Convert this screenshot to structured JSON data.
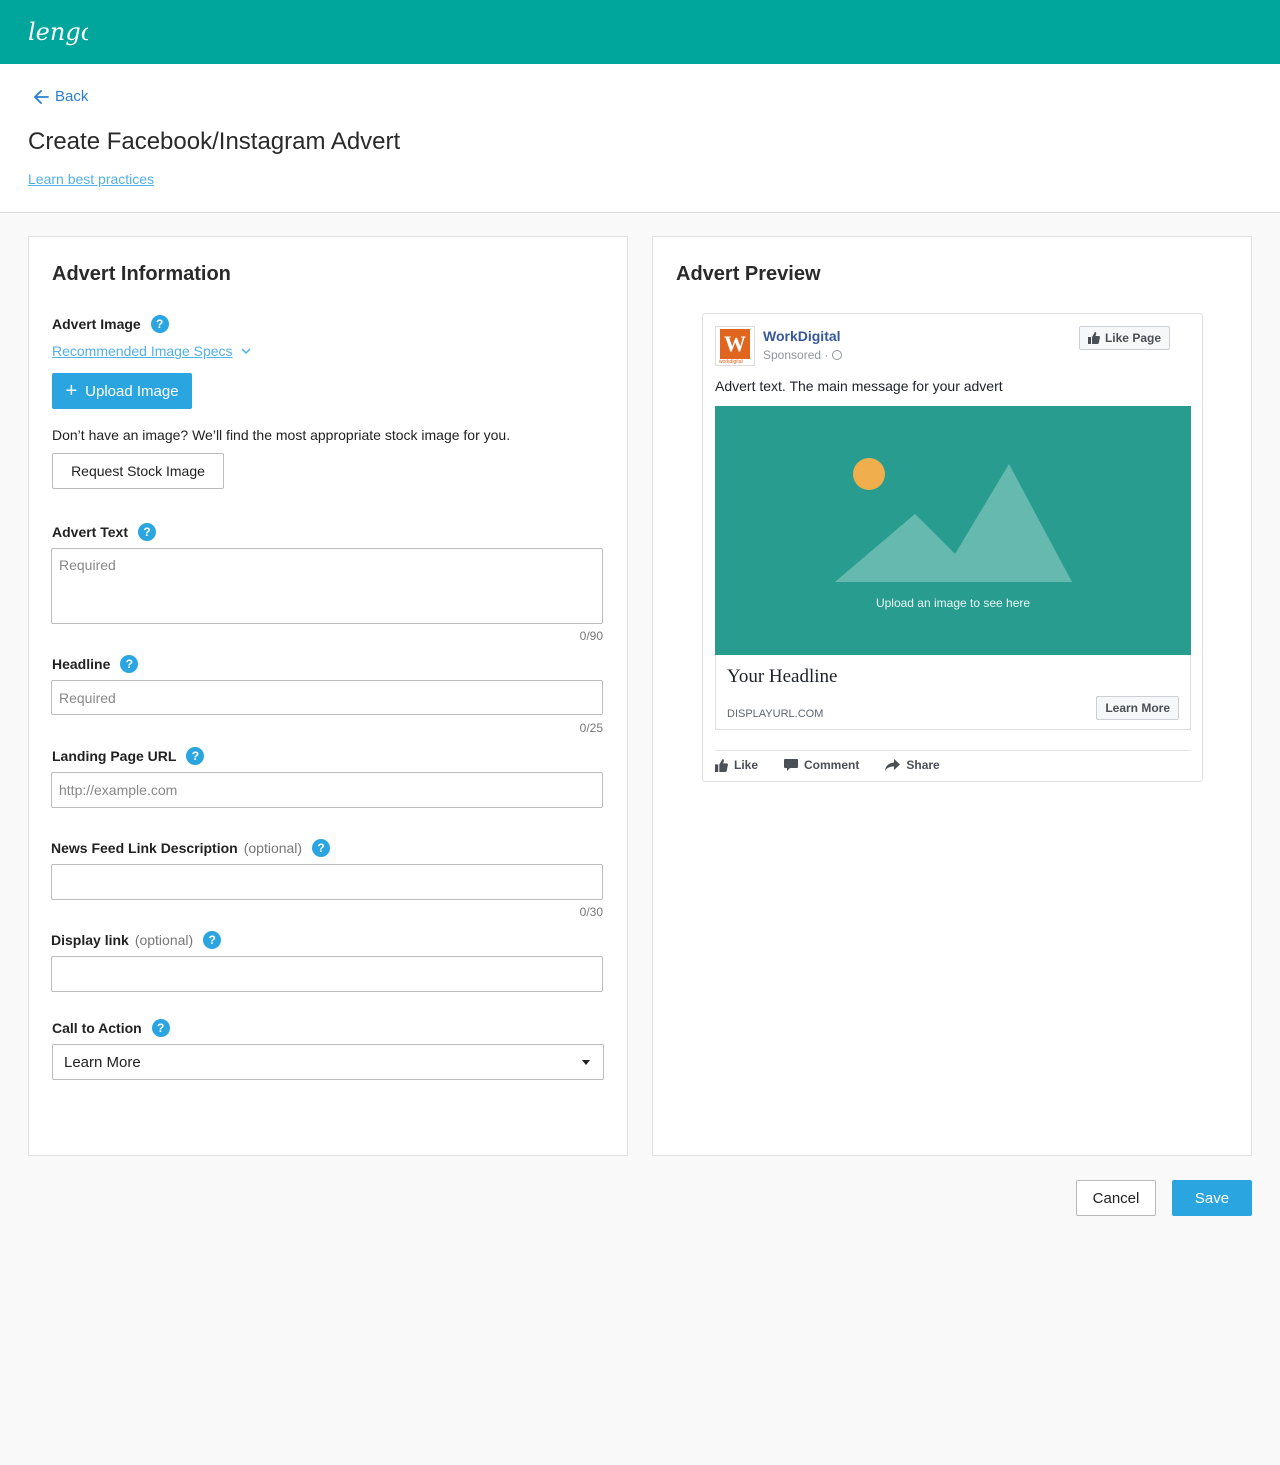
{
  "app": {
    "logo_text": "lengo",
    "brand_color": "#00a69c",
    "accent_color": "#2aa5e0"
  },
  "header": {
    "back_label": "Back",
    "title": "Create Facebook/Instagram Advert",
    "best_practices_link": "Learn best practices"
  },
  "form": {
    "title": "Advert Information",
    "image": {
      "label": "Advert Image",
      "specs_link": "Recommended Image Specs",
      "upload_label": "Upload Image",
      "stock_note": "Don’t have an image? We’ll find the most appropriate stock image for you.",
      "stock_button": "Request Stock Image"
    },
    "advert_text": {
      "label": "Advert Text",
      "placeholder": "Required",
      "value": "",
      "counter": "0/90"
    },
    "headline": {
      "label": "Headline",
      "placeholder": "Required",
      "value": "",
      "counter": "0/25"
    },
    "landing_url": {
      "label": "Landing Page URL",
      "placeholder": "http://example.com",
      "value": ""
    },
    "news_feed": {
      "label": "News Feed Link Description",
      "optional": "(optional)",
      "value": "",
      "counter": "0/30"
    },
    "display_link": {
      "label": "Display link",
      "optional": "(optional)",
      "value": ""
    },
    "cta": {
      "label": "Call to Action",
      "selected": "Learn More"
    }
  },
  "preview": {
    "title": "Advert Preview",
    "page_name": "WorkDigital",
    "avatar_letter": "W",
    "avatar_caption": "workdigital",
    "sponsored": "Sponsored ·",
    "like_page": "Like Page",
    "advert_text": "Advert text. The main message for your advert",
    "image_caption": "Upload an image to see here",
    "headline": "Your Headline",
    "display_url": "DISPLAYURL.COM",
    "cta_button": "Learn More",
    "actions": {
      "like": "Like",
      "comment": "Comment",
      "share": "Share"
    },
    "image_bg": "#289d8f",
    "sun_color": "#f0ae4d"
  },
  "footer": {
    "cancel": "Cancel",
    "save": "Save"
  }
}
